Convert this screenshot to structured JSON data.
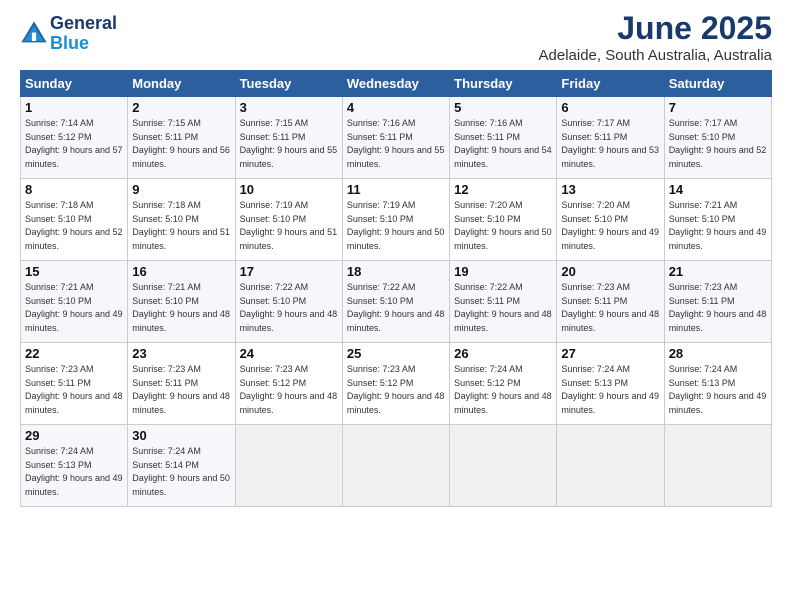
{
  "header": {
    "logo_line1": "General",
    "logo_line2": "Blue",
    "month": "June 2025",
    "location": "Adelaide, South Australia, Australia"
  },
  "columns": [
    "Sunday",
    "Monday",
    "Tuesday",
    "Wednesday",
    "Thursday",
    "Friday",
    "Saturday"
  ],
  "weeks": [
    [
      {
        "day": "1",
        "sunrise": "7:14 AM",
        "sunset": "5:12 PM",
        "daylight": "9 hours and 57 minutes."
      },
      {
        "day": "2",
        "sunrise": "7:15 AM",
        "sunset": "5:11 PM",
        "daylight": "9 hours and 56 minutes."
      },
      {
        "day": "3",
        "sunrise": "7:15 AM",
        "sunset": "5:11 PM",
        "daylight": "9 hours and 55 minutes."
      },
      {
        "day": "4",
        "sunrise": "7:16 AM",
        "sunset": "5:11 PM",
        "daylight": "9 hours and 55 minutes."
      },
      {
        "day": "5",
        "sunrise": "7:16 AM",
        "sunset": "5:11 PM",
        "daylight": "9 hours and 54 minutes."
      },
      {
        "day": "6",
        "sunrise": "7:17 AM",
        "sunset": "5:11 PM",
        "daylight": "9 hours and 53 minutes."
      },
      {
        "day": "7",
        "sunrise": "7:17 AM",
        "sunset": "5:10 PM",
        "daylight": "9 hours and 52 minutes."
      }
    ],
    [
      {
        "day": "8",
        "sunrise": "7:18 AM",
        "sunset": "5:10 PM",
        "daylight": "9 hours and 52 minutes."
      },
      {
        "day": "9",
        "sunrise": "7:18 AM",
        "sunset": "5:10 PM",
        "daylight": "9 hours and 51 minutes."
      },
      {
        "day": "10",
        "sunrise": "7:19 AM",
        "sunset": "5:10 PM",
        "daylight": "9 hours and 51 minutes."
      },
      {
        "day": "11",
        "sunrise": "7:19 AM",
        "sunset": "5:10 PM",
        "daylight": "9 hours and 50 minutes."
      },
      {
        "day": "12",
        "sunrise": "7:20 AM",
        "sunset": "5:10 PM",
        "daylight": "9 hours and 50 minutes."
      },
      {
        "day": "13",
        "sunrise": "7:20 AM",
        "sunset": "5:10 PM",
        "daylight": "9 hours and 49 minutes."
      },
      {
        "day": "14",
        "sunrise": "7:21 AM",
        "sunset": "5:10 PM",
        "daylight": "9 hours and 49 minutes."
      }
    ],
    [
      {
        "day": "15",
        "sunrise": "7:21 AM",
        "sunset": "5:10 PM",
        "daylight": "9 hours and 49 minutes."
      },
      {
        "day": "16",
        "sunrise": "7:21 AM",
        "sunset": "5:10 PM",
        "daylight": "9 hours and 48 minutes."
      },
      {
        "day": "17",
        "sunrise": "7:22 AM",
        "sunset": "5:10 PM",
        "daylight": "9 hours and 48 minutes."
      },
      {
        "day": "18",
        "sunrise": "7:22 AM",
        "sunset": "5:10 PM",
        "daylight": "9 hours and 48 minutes."
      },
      {
        "day": "19",
        "sunrise": "7:22 AM",
        "sunset": "5:11 PM",
        "daylight": "9 hours and 48 minutes."
      },
      {
        "day": "20",
        "sunrise": "7:23 AM",
        "sunset": "5:11 PM",
        "daylight": "9 hours and 48 minutes."
      },
      {
        "day": "21",
        "sunrise": "7:23 AM",
        "sunset": "5:11 PM",
        "daylight": "9 hours and 48 minutes."
      }
    ],
    [
      {
        "day": "22",
        "sunrise": "7:23 AM",
        "sunset": "5:11 PM",
        "daylight": "9 hours and 48 minutes."
      },
      {
        "day": "23",
        "sunrise": "7:23 AM",
        "sunset": "5:11 PM",
        "daylight": "9 hours and 48 minutes."
      },
      {
        "day": "24",
        "sunrise": "7:23 AM",
        "sunset": "5:12 PM",
        "daylight": "9 hours and 48 minutes."
      },
      {
        "day": "25",
        "sunrise": "7:23 AM",
        "sunset": "5:12 PM",
        "daylight": "9 hours and 48 minutes."
      },
      {
        "day": "26",
        "sunrise": "7:24 AM",
        "sunset": "5:12 PM",
        "daylight": "9 hours and 48 minutes."
      },
      {
        "day": "27",
        "sunrise": "7:24 AM",
        "sunset": "5:13 PM",
        "daylight": "9 hours and 49 minutes."
      },
      {
        "day": "28",
        "sunrise": "7:24 AM",
        "sunset": "5:13 PM",
        "daylight": "9 hours and 49 minutes."
      }
    ],
    [
      {
        "day": "29",
        "sunrise": "7:24 AM",
        "sunset": "5:13 PM",
        "daylight": "9 hours and 49 minutes."
      },
      {
        "day": "30",
        "sunrise": "7:24 AM",
        "sunset": "5:14 PM",
        "daylight": "9 hours and 50 minutes."
      },
      null,
      null,
      null,
      null,
      null
    ]
  ]
}
